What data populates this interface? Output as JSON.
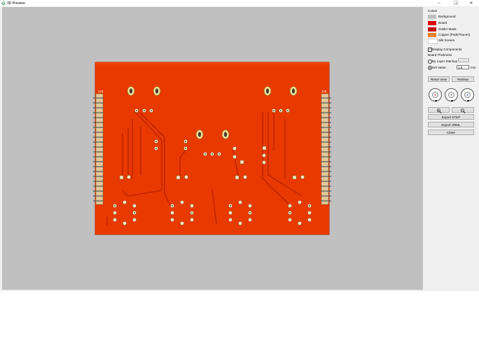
{
  "window": {
    "title": "3D Preview"
  },
  "colors": {
    "heading": "Colors",
    "items": [
      {
        "label": "Background",
        "color": "#c0c0c0"
      },
      {
        "label": "Board",
        "color": "#e00000"
      },
      {
        "label": "Solder Mask",
        "color": "#c81010"
      },
      {
        "label": "Copper (Pads/Traces)",
        "color": "#f08020"
      },
      {
        "label": "Silk Screen",
        "color": "#ffffff"
      }
    ]
  },
  "display_components": {
    "label": "Display Components",
    "checked": true
  },
  "board_thickness": {
    "heading": "Board Thickness",
    "by_layer_stackup": "By Layer Stackup",
    "set_value": "Set Value:",
    "value": "1.6",
    "unit": "mm"
  },
  "buttons": {
    "reset_view": "Reset View",
    "redraw": "Redraw",
    "export_step": "Export STEP",
    "export_vrml": "Export VRML",
    "close": "Close"
  },
  "axes": {
    "x": "X",
    "y": "Y",
    "z": "Z"
  },
  "pcb": {
    "board_color": "#e83a00",
    "ref_left": "J15",
    "ref_right": "J16"
  }
}
